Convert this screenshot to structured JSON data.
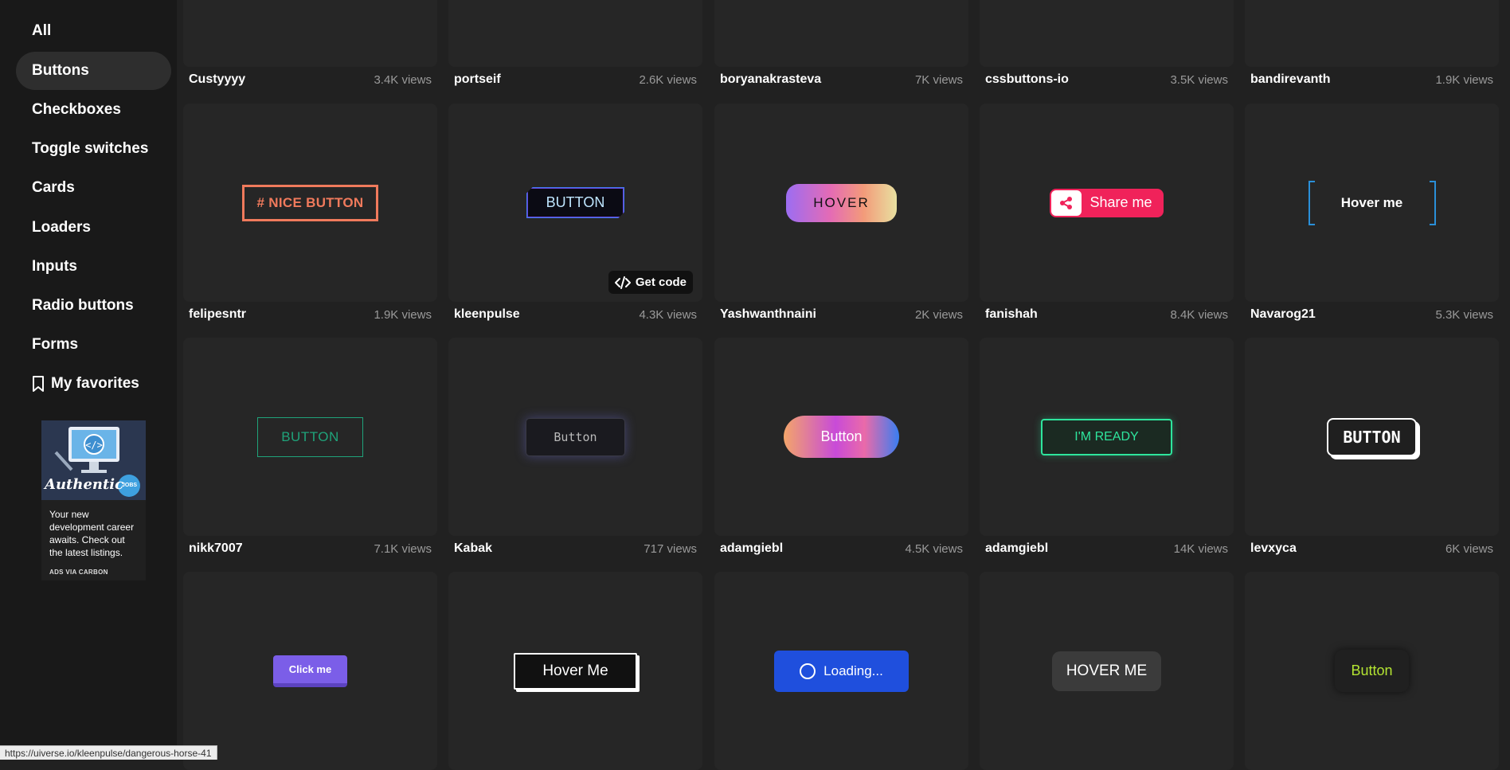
{
  "sidebar": {
    "items": [
      {
        "label": "All"
      },
      {
        "label": "Buttons"
      },
      {
        "label": "Checkboxes"
      },
      {
        "label": "Toggle switches"
      },
      {
        "label": "Cards"
      },
      {
        "label": "Loaders"
      },
      {
        "label": "Inputs"
      },
      {
        "label": "Radio buttons"
      },
      {
        "label": "Forms"
      },
      {
        "label": "My favorites"
      }
    ],
    "active": "Buttons",
    "ad": {
      "logo_text": "Authentic",
      "badge": "JOBS",
      "text": "Your new development career awaits. Check out the latest listings.",
      "via": "ADS VIA CARBON"
    }
  },
  "grid": {
    "top_row": [
      {
        "author": "Custyyyy",
        "views": "3.4K views"
      },
      {
        "author": "portseif",
        "views": "2.6K views"
      },
      {
        "author": "boryanakrasteva",
        "views": "7K views"
      },
      {
        "author": "cssbuttons-io",
        "views": "3.5K views"
      },
      {
        "author": "bandirevanth",
        "views": "1.9K views"
      }
    ],
    "row1": [
      {
        "author": "felipesntr",
        "views": "1.9K views",
        "button": "# NICE BUTTON"
      },
      {
        "author": "kleenpulse",
        "views": "4.3K views",
        "button": "BUTTON",
        "get_code": "Get code"
      },
      {
        "author": "Yashwanthnaini",
        "views": "2K views",
        "button": "HOVER"
      },
      {
        "author": "fanishah",
        "views": "8.4K views",
        "button": "Share me"
      },
      {
        "author": "Navarog21",
        "views": "5.3K views",
        "button": "Hover me"
      }
    ],
    "row2": [
      {
        "author": "nikk7007",
        "views": "7.1K views",
        "button": "BUTTON"
      },
      {
        "author": "Kabak",
        "views": "717 views",
        "button": "Button"
      },
      {
        "author": "adamgiebl",
        "views": "4.5K views",
        "button": "Button"
      },
      {
        "author": "adamgiebl",
        "views": "14K views",
        "button": "I'M READY"
      },
      {
        "author": "levxyca",
        "views": "6K views",
        "button": "BUTTON"
      }
    ],
    "row3": [
      {
        "button": "Click me"
      },
      {
        "button": "Hover Me"
      },
      {
        "button": "Loading..."
      },
      {
        "button": "HOVER ME"
      },
      {
        "button": "Button"
      }
    ]
  },
  "status_url": "https://uiverse.io/kleenpulse/dangerous-horse-41",
  "colors": {
    "background": "#212121",
    "card": "#262626",
    "sidebar": "#191919",
    "accent_link": "#f0225a"
  }
}
